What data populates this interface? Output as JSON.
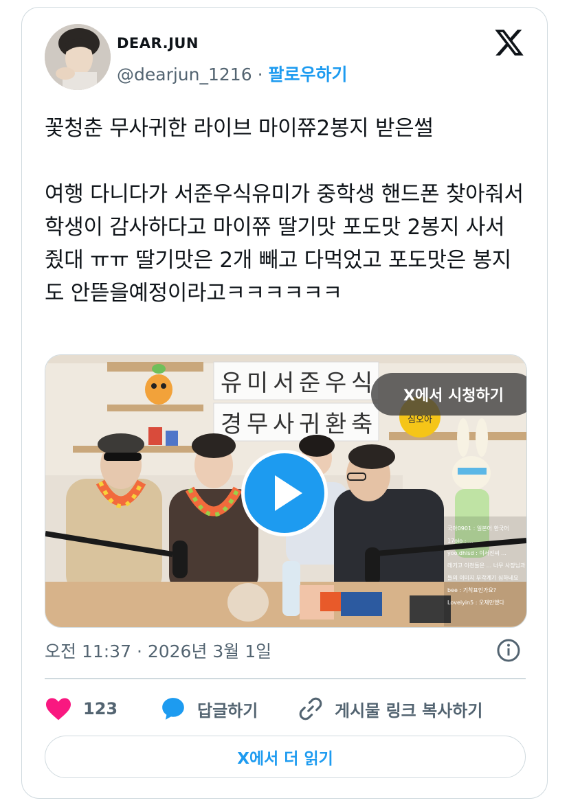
{
  "author": {
    "display_name": "DEAR.JUN",
    "handle": "@dearjun_1216",
    "separator": "·",
    "follow_label": "팔로우하기"
  },
  "tweet": {
    "text": "꽃청춘 무사귀한 라이브 마이쮸2봉지 받은썰\n\n여행 다니다가 서준우식유미가 중학생 핸드폰 찾아줘서 학생이 감사하다고 마이쮸 딸기맛 포도맛 2봉지 사서 줬대 ㅠㅠ 딸기맛은 2개 빼고 다먹었고 포도맛은 봉지도 안뜯을예정이라고ㅋㅋㅋㅋㅋㅋ"
  },
  "media": {
    "watch_label": "X에서 시청하기",
    "sign_line1": [
      "유",
      "미",
      "서",
      "준",
      "우",
      "식"
    ],
    "sign_line2": [
      "경",
      "무",
      "사",
      "귀",
      "환",
      "축"
    ],
    "sticker_text": "심오아",
    "chat_lines": [
      "국아0901 : 일본어 한국어",
      "17olo : ...",
      "yoo.dhlsd : 이서진씨 ...",
      "레기고 이천들은 ... 너무 사장님과 직원",
      "들의 이미지 부각계기 심하네요",
      "bee : 기착표인가요?",
      "Lovelyin5 : 오재만했다"
    ],
    "colors": {
      "wall": "#efe9df",
      "shelf": "#c9a77b",
      "table": "#d7b38a"
    }
  },
  "meta": {
    "timestamp": "오전 11:37 · 2026년 3월 1일"
  },
  "actions": {
    "like_count": "123",
    "reply_label": "답글하기",
    "copy_link_label": "게시물 링크 복사하기"
  },
  "footer": {
    "read_more_label": "X에서 더 읽기"
  },
  "colors": {
    "accent": "#1d9bf0",
    "like": "#f91880",
    "muted": "#536471",
    "border": "#cfd9de"
  }
}
